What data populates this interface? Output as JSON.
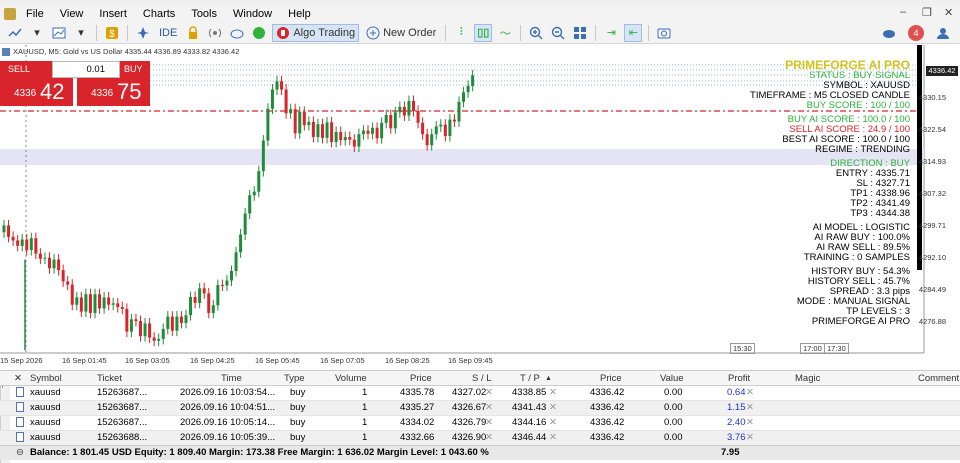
{
  "titlebar": {
    "text": ""
  },
  "menu": [
    "File",
    "View",
    "Insert",
    "Charts",
    "Tools",
    "Window",
    "Help"
  ],
  "toolbar": {
    "algo_trading": "Algo Trading",
    "new_order": "New Order",
    "ide": "IDE",
    "notifications": "4"
  },
  "chart": {
    "header": "XAUUSD, M5: Gold vs US Dollar  4335.44 4336.89 4333.82 4336.42",
    "trade": {
      "sell_label": "SELL",
      "buy_label": "BUY",
      "lot": "0.01",
      "sell_small": "4336",
      "sell_big": "42",
      "buy_small": "4336",
      "buy_big": "75"
    },
    "price_axis": [
      "4336.42",
      "4330.15",
      "4322.54",
      "4314.93",
      "4307.32",
      "4299.71",
      "4292.10",
      "4284.49",
      "4276.88"
    ],
    "time_axis": [
      "15 Sep 2026",
      "16 Sep 01:45",
      "16 Sep 03:05",
      "16 Sep 04:25",
      "16 Sep 05:45",
      "16 Sep 07:05",
      "16 Sep 08:25",
      "16 Sep 09:45"
    ],
    "time_markers": [
      "15:30",
      "17:00",
      "17:30"
    ],
    "current_price": "4336.42",
    "colors": {
      "bull": "#1e8c3a",
      "bear": "#d8242a",
      "buy_zone": "#e4e4f4",
      "gold": "#d4c31c"
    }
  },
  "chart_data": {
    "type": "candlestick",
    "title": "XAUUSD, M5",
    "ylim": [
      4272,
      4340
    ],
    "closes": [
      4303.5,
      4301,
      4300.2,
      4299,
      4300.4,
      4298.1,
      4300.7,
      4297.3,
      4296.2,
      4296.4,
      4294.1,
      4296,
      4293.7,
      4291.2,
      4290.5,
      4286.1,
      4287.7,
      4284.6,
      4288.4,
      4284.3,
      4288.4,
      4285.3,
      4287.7,
      4286.1,
      4286.4,
      4285.6,
      4285.2,
      4280.2,
      4282.9,
      4282.5,
      4279.2,
      4282,
      4278.9,
      4278.2,
      4278.6,
      4280.8,
      4283.5,
      4280.4,
      4283.5,
      4282.1,
      4283.8,
      4287.8,
      4286.5,
      4289.7,
      4288.6,
      4284.3,
      4286,
      4290.4,
      4290.3,
      4291.4,
      4293.5,
      4297.6,
      4301.5,
      4306.1,
      4310.1,
      4310.9,
      4315.4,
      4322.1,
      4329.1,
      4333.3,
      4335.1,
      4333.3,
      4328.1,
      4329,
      4323.7,
      4328.4,
      4325.5,
      4326.2,
      4322.9,
      4325.7,
      4322.7,
      4326.1,
      4321.8,
      4324,
      4322.2,
      4322.9,
      4322.3,
      4320.8,
      4323.5,
      4324.3,
      4323.6,
      4324.9,
      4322.6,
      4326,
      4327.7,
      4324.8,
      4328.3,
      4329.5,
      4327.6,
      4330.8,
      4328.6,
      4326,
      4323.5,
      4321.1,
      4323.5,
      4325.2,
      4325.6,
      4323.1,
      4326.7,
      4326.3,
      4330.6,
      4332.7,
      4334.1,
      4336.4
    ]
  },
  "ai_panel": {
    "title": "PRIMEFORGE AI PRO",
    "lines": [
      {
        "text": "STATUS        : BUY SIGNAL",
        "color": "#2db23a"
      },
      {
        "text": "SYMBOL        : XAUUSD",
        "color": "#000000"
      },
      {
        "text": "TIMEFRAME     : M5 CLOSED CANDLE",
        "color": "#000000"
      },
      {
        "text": "BUY SCORE     : 100 / 100",
        "color": "#2db23a"
      },
      {
        "text": "",
        "color": "#000000"
      },
      {
        "text": "BUY AI SCORE  : 100.0 / 100",
        "color": "#2db23a"
      },
      {
        "text": "SELL AI SCORE : 24.9 / 100",
        "color": "#d8242a"
      },
      {
        "text": "BEST AI SCORE : 100.0 / 100",
        "color": "#000000"
      },
      {
        "text": "REGIME        : TRENDING",
        "color": "#000000"
      },
      {
        "text": "",
        "color": "#000000"
      },
      {
        "text": "DIRECTION     : BUY",
        "color": "#2db23a"
      },
      {
        "text": "ENTRY         : 4335.71",
        "color": "#000000"
      },
      {
        "text": "SL            : 4327.71",
        "color": "#000000"
      },
      {
        "text": "TP1           : 4338.96",
        "color": "#000000"
      },
      {
        "text": "TP2           : 4341.49",
        "color": "#000000"
      },
      {
        "text": "TP3           : 4344.38",
        "color": "#000000"
      },
      {
        "text": "",
        "color": "#000000"
      },
      {
        "text": "AI MODEL      : LOGISTIC",
        "color": "#000000"
      },
      {
        "text": "AI RAW BUY    : 100.0%",
        "color": "#000000"
      },
      {
        "text": "AI RAW SELL   : 89.5%",
        "color": "#000000"
      },
      {
        "text": "TRAINING      : 0 SAMPLES",
        "color": "#000000"
      },
      {
        "text": "",
        "color": "#000000"
      },
      {
        "text": "HISTORY BUY   : 54.3%",
        "color": "#000000"
      },
      {
        "text": "HISTORY SELL  : 45.7%",
        "color": "#000000"
      },
      {
        "text": "SPREAD        : 3.3 pips",
        "color": "#000000"
      },
      {
        "text": "MODE          : MANUAL SIGNAL",
        "color": "#000000"
      },
      {
        "text": "TP LEVELS     : 3",
        "color": "#000000"
      },
      {
        "text": "PRIMEFORGE AI PRO",
        "color": "#000000"
      }
    ]
  },
  "table": {
    "headers": [
      "Symbol",
      "Ticket",
      "Time",
      "Type",
      "Volume",
      "Price",
      "S / L",
      "T / P",
      "Price",
      "Value",
      "Profit",
      "Magic",
      "Comment"
    ],
    "rows": [
      {
        "symbol": "xauusd",
        "ticket": "15263687...",
        "time": "2026.09.16 10:03:54...",
        "type": "buy",
        "volume": "1",
        "price": "4335.78",
        "sl": "4327.02",
        "tp": "4338.85",
        "cur": "4336.42",
        "value": "0.00",
        "profit": "0.64"
      },
      {
        "symbol": "xauusd",
        "ticket": "15263687...",
        "time": "2026.09.16 10:04:51...",
        "type": "buy",
        "volume": "1",
        "price": "4335.27",
        "sl": "4326.67",
        "tp": "4341.43",
        "cur": "4336.42",
        "value": "0.00",
        "profit": "1.15"
      },
      {
        "symbol": "xauusd",
        "ticket": "15263687...",
        "time": "2026.09.16 10:05:14...",
        "type": "buy",
        "volume": "1",
        "price": "4334.02",
        "sl": "4326.79",
        "tp": "4344.16",
        "cur": "4336.42",
        "value": "0.00",
        "profit": "2.40"
      },
      {
        "symbol": "xauusd",
        "ticket": "15263688...",
        "time": "2026.09.16 10:05:39...",
        "type": "buy",
        "volume": "1",
        "price": "4332.66",
        "sl": "4326.90",
        "tp": "4346.44",
        "cur": "4336.42",
        "value": "0.00",
        "profit": "3.76"
      }
    ],
    "footer": "Balance: 1 801.45 USD  Equity: 1 809.40  Margin: 173.38  Free Margin: 1 636.02  Margin Level: 1 043.60 %",
    "footer_total": "7.95",
    "side_tab": "Tbox"
  }
}
